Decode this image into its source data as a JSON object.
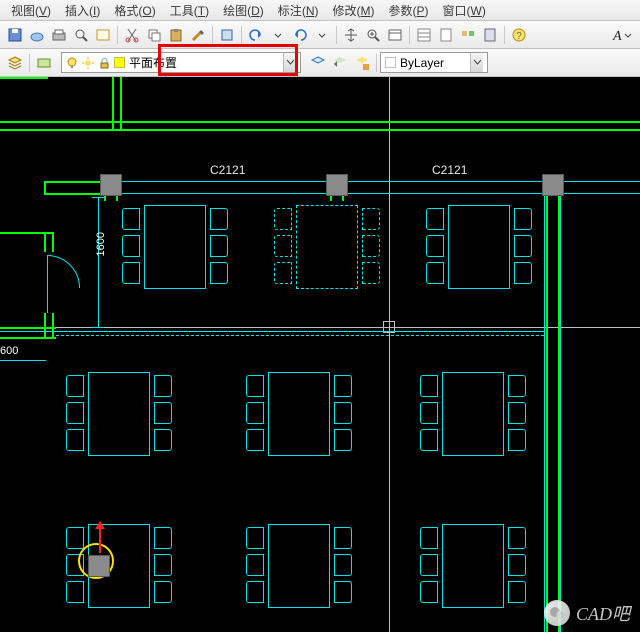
{
  "menu": {
    "items": [
      {
        "label": "视图",
        "key": "V"
      },
      {
        "label": "插入",
        "key": "I"
      },
      {
        "label": "格式",
        "key": "O"
      },
      {
        "label": "工具",
        "key": "T"
      },
      {
        "label": "绘图",
        "key": "D"
      },
      {
        "label": "标注",
        "key": "N"
      },
      {
        "label": "修改",
        "key": "M"
      },
      {
        "label": "参数",
        "key": "P"
      },
      {
        "label": "窗口",
        "key": "W"
      }
    ]
  },
  "toolbar1": {
    "icons": [
      "new",
      "open",
      "save",
      "cloud",
      "plot",
      "preview",
      "publish",
      "cut",
      "copy",
      "paste",
      "match",
      "undo",
      "redo",
      "pan",
      "zoom",
      "props",
      "help",
      "text-style"
    ]
  },
  "layer": {
    "current": "平面布置",
    "combo_icons": [
      "light",
      "freeze",
      "lock",
      "color"
    ]
  },
  "bylayer": {
    "label": "ByLayer"
  },
  "drawing": {
    "window_tags": [
      "C2121",
      "C2121"
    ],
    "dim_v": "1600",
    "dim_h": "600"
  },
  "watermark": {
    "text": "CAD吧"
  }
}
